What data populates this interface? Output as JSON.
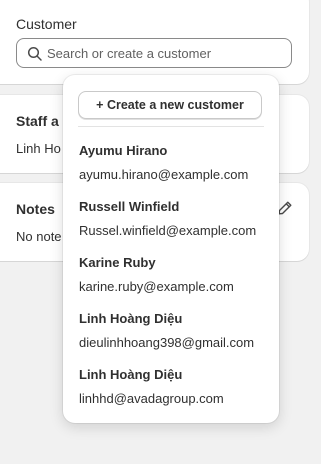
{
  "customer_card": {
    "label": "Customer",
    "search": {
      "placeholder": "Search or create a customer",
      "icon": "search-icon"
    }
  },
  "staff_card": {
    "title": "Staff a",
    "value": "Linh Ho"
  },
  "notes_card": {
    "title": "Notes",
    "value": "No note",
    "edit_icon": "pencil-icon"
  },
  "dropdown": {
    "create_label": "+ Create a new customer",
    "options": [
      {
        "name": "Ayumu Hirano",
        "email": "ayumu.hirano@example.com"
      },
      {
        "name": "Russell Winfield",
        "email": "Russel.winfield@example.com"
      },
      {
        "name": "Karine Ruby",
        "email": "karine.ruby@example.com"
      },
      {
        "name": "Linh Hoàng Diệu",
        "email": "dieulinhhoang398@gmail.com"
      },
      {
        "name": "Linh Hoàng Diệu",
        "email": "linhhd@avadagroup.com"
      }
    ]
  },
  "colors": {
    "page_bg": "#f1f1f1",
    "card_bg": "#ffffff",
    "text": "#303030",
    "placeholder": "#616161",
    "input_border": "#8a8a8a"
  }
}
